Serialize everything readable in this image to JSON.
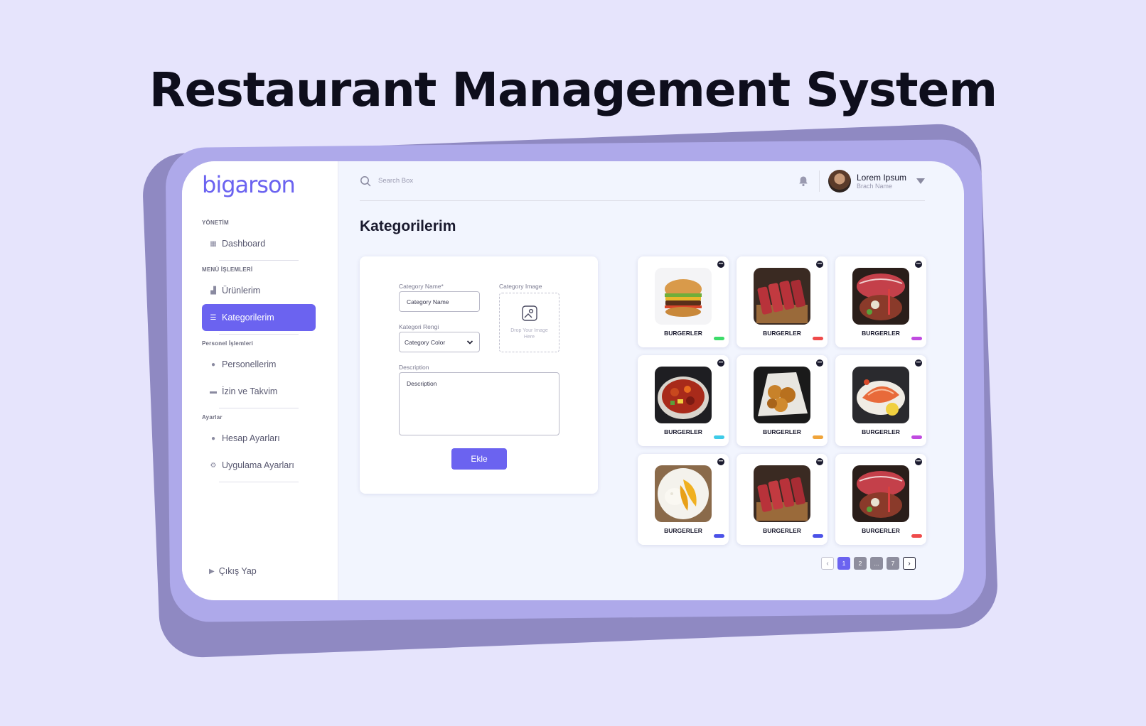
{
  "hero": {
    "title": "Restaurant Management  System"
  },
  "brand": {
    "logo_text": "bigarson",
    "accent": "#6b63f0"
  },
  "sidebar": {
    "sections": [
      {
        "label": "YÖNETİM",
        "items": [
          {
            "label": "Dashboard",
            "icon": "grid-icon"
          }
        ]
      },
      {
        "label": "MENÜ İŞLEMLERİ",
        "items": [
          {
            "label": "Ürünlerim",
            "icon": "store-icon"
          },
          {
            "label": "Kategorilerim",
            "icon": "list-icon",
            "active": true
          }
        ]
      },
      {
        "label": "Personel İşlemleri",
        "items": [
          {
            "label": "Personellerim",
            "icon": "user-icon"
          },
          {
            "label": "İzin ve Takvim",
            "icon": "calendar-icon"
          }
        ]
      },
      {
        "label": "Ayarlar",
        "items": [
          {
            "label": "Hesap Ayarları",
            "icon": "user-settings-icon"
          },
          {
            "label": "Uygulama Ayarları",
            "icon": "gear-icon"
          }
        ]
      }
    ],
    "logout_label": "Çıkış Yap"
  },
  "topbar": {
    "search_placeholder": "Search Box",
    "user_name": "Lorem Ipsum",
    "user_branch": "Brach Name"
  },
  "page": {
    "title": "Kategorilerim"
  },
  "form": {
    "name_label": "Category Name*",
    "name_placeholder": "Category Name",
    "image_label": "Category Image",
    "drop_text": "Drop Your Image Here",
    "color_label": "Kategori Rengi",
    "color_value": "Category Color",
    "desc_label": "Description",
    "desc_placeholder": "Description",
    "submit_label": "Ekle"
  },
  "categories": [
    {
      "name": "BURGERLER",
      "color": "#3ddc6a",
      "image": "burger"
    },
    {
      "name": "BURGERLER",
      "color": "#ef4b4b",
      "image": "steak"
    },
    {
      "name": "BURGERLER",
      "color": "#c04be0",
      "image": "wagyu"
    },
    {
      "name": "BURGERLER",
      "color": "#3ecbe8",
      "image": "sweet-sour"
    },
    {
      "name": "BURGERLER",
      "color": "#f0a43a",
      "image": "fried-chicken"
    },
    {
      "name": "BURGERLER",
      "color": "#c04be0",
      "image": "salmon"
    },
    {
      "name": "BURGERLER",
      "color": "#4b52e8",
      "image": "mango-rice"
    },
    {
      "name": "BURGERLER",
      "color": "#4b52e8",
      "image": "steak"
    },
    {
      "name": "BURGERLER",
      "color": "#ef4b4b",
      "image": "wagyu"
    }
  ],
  "pagination": {
    "pages": [
      "1",
      "2",
      "...",
      "7"
    ],
    "current": "1"
  }
}
